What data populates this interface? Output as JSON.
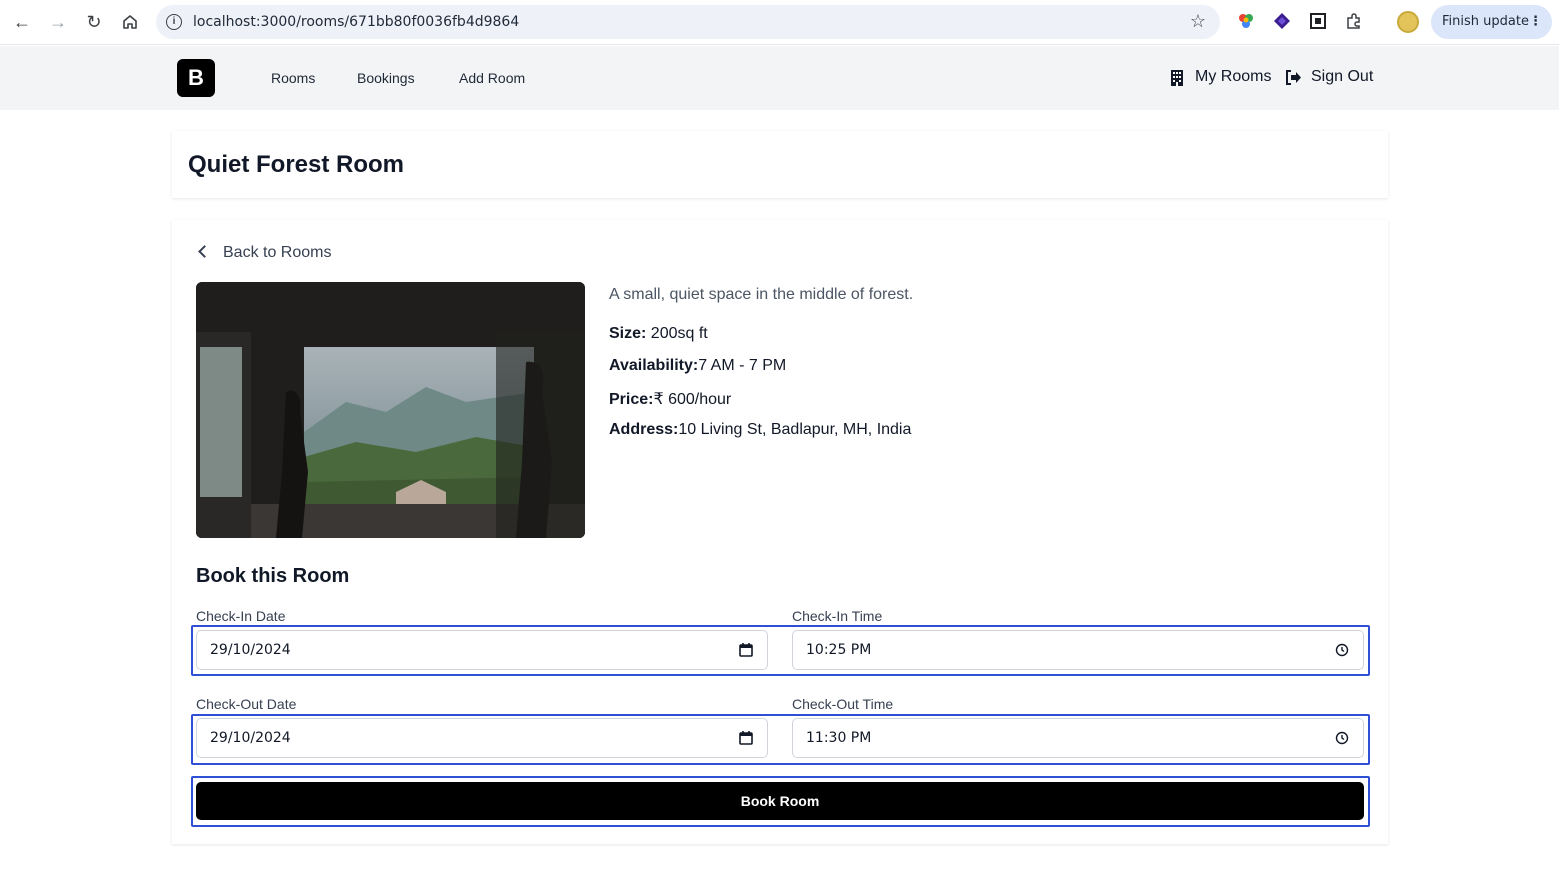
{
  "browser": {
    "url": "localhost:3000/rooms/671bb80f0036fb4d9864",
    "update_label": "Finish update"
  },
  "header": {
    "logo": "B",
    "nav": [
      "Rooms",
      "Bookings",
      "Add Room"
    ],
    "my_rooms": "My Rooms",
    "sign_out": "Sign Out"
  },
  "room": {
    "title": "Quiet Forest Room",
    "back_label": "Back to Rooms",
    "description": "A small, quiet space in the middle of forest.",
    "size_label": "Size:",
    "size_value": " 200sq ft",
    "availability_label": "Availability:",
    "availability_value": "7 AM - 7 PM",
    "price_label": "Price:",
    "price_value": "₹ 600/hour",
    "address_label": "Address:",
    "address_value": "10 Living St, Badlapur, MH, India"
  },
  "booking": {
    "title": "Book this Room",
    "checkin_date_label": "Check-In Date",
    "checkin_date": "29/10/2024",
    "checkin_time_label": "Check-In Time",
    "checkin_time": "10:25  PM",
    "checkout_date_label": "Check-Out Date",
    "checkout_date": "29/10/2024",
    "checkout_time_label": "Check-Out Time",
    "checkout_time": "11:30  PM",
    "submit_label": "Book Room"
  }
}
